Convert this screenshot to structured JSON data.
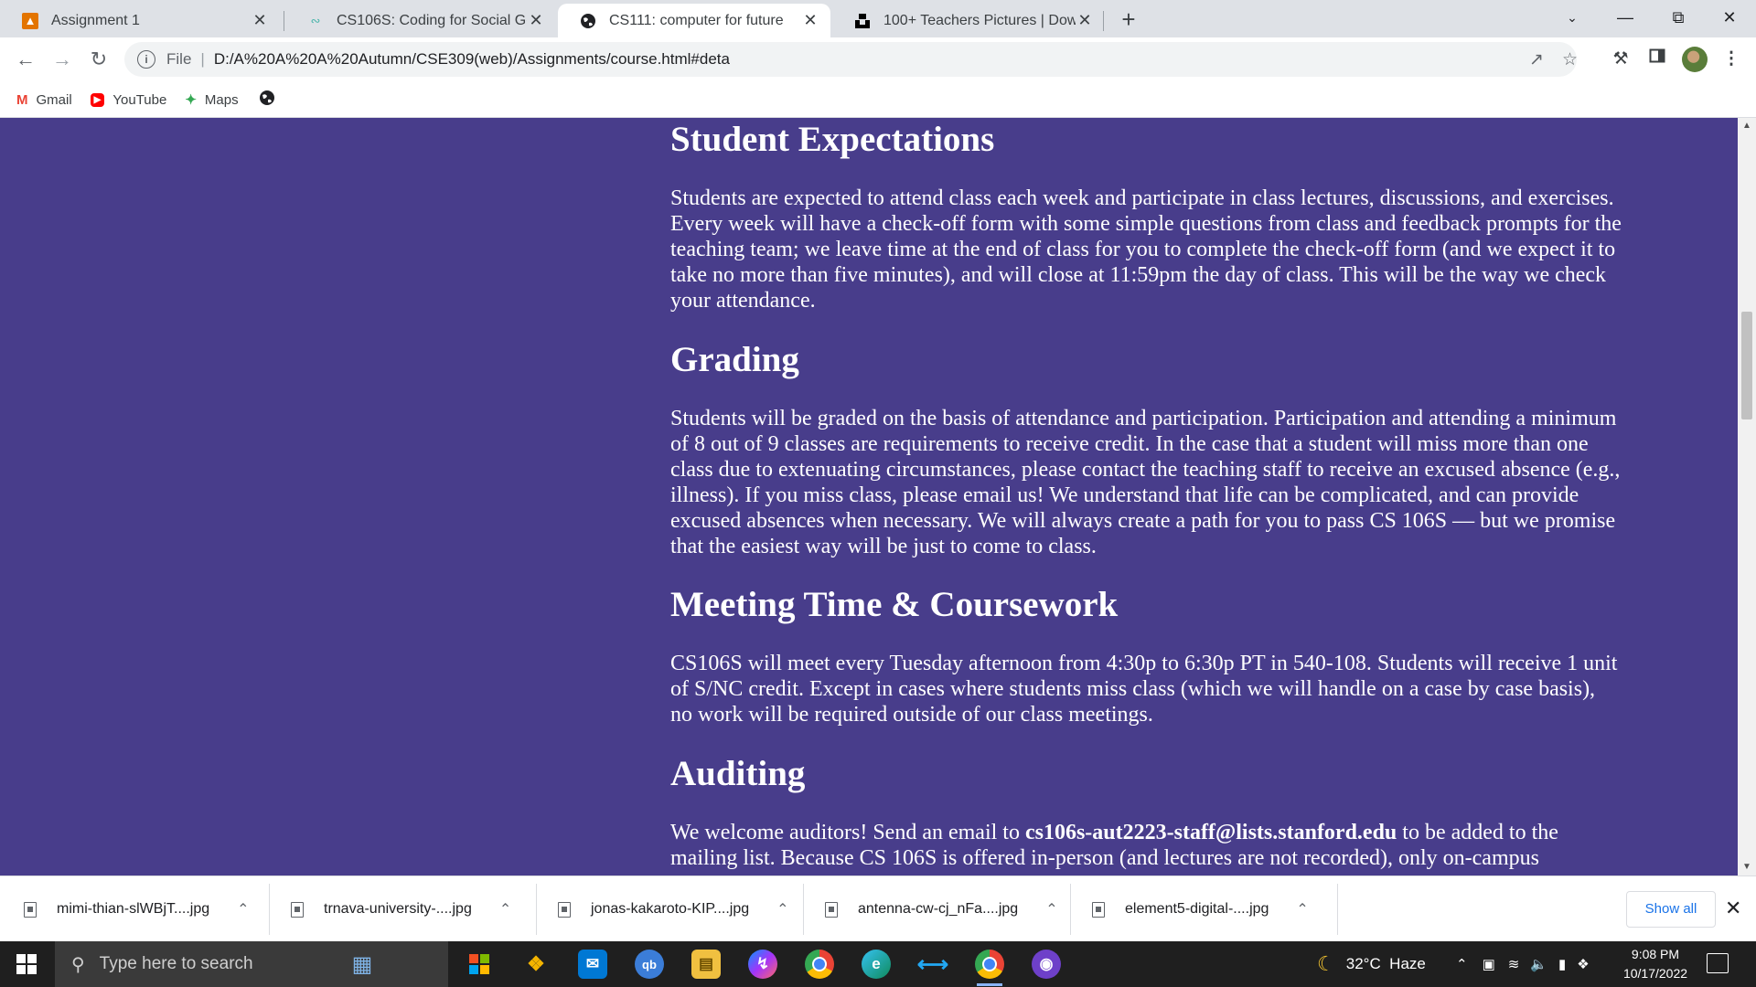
{
  "browser": {
    "tabs": [
      {
        "title": "Assignment 1",
        "favicon": "classroom-icon",
        "color": "#e37400"
      },
      {
        "title": "CS106S: Coding for Social Good",
        "favicon": "cs106s-icon",
        "color": "#4db6ac"
      },
      {
        "title": "CS111: computer for future",
        "favicon": "globe-icon",
        "color": "#202124"
      },
      {
        "title": "100+ Teachers Pictures | Downlo",
        "favicon": "unsplash-icon",
        "color": "#000000"
      }
    ],
    "address": {
      "scheme_label": "File",
      "url": "D:/A%20A%20A%20Autumn/CSE309(web)/Assignments/course.html#deta"
    },
    "bookmarks": [
      {
        "label": "Gmail",
        "icon": "gmail-icon"
      },
      {
        "label": "YouTube",
        "icon": "youtube-icon"
      },
      {
        "label": "Maps",
        "icon": "maps-icon"
      }
    ]
  },
  "article": {
    "sections": [
      {
        "heading": "Student Expectations",
        "body": "Students are expected to attend class each week and participate in class lectures, discussions, and exercises. Every week will have a check-off form with some simple questions from class and feedback prompts for the teaching team; we leave time at the end of class for you to complete the check-off form (and we expect it to take no more than five minutes), and will close at 11:59pm the day of class. This will be the way we check your attendance."
      },
      {
        "heading": "Grading",
        "body": "Students will be graded on the basis of attendance and participation. Participation and attending a minimum of 8 out of 9 classes are requirements to receive credit. In the case that a student will miss more than one class due to extenuating circumstances, please contact the teaching staff to receive an excused absence (e.g., illness). If you miss class, please email us! We understand that life can be complicated, and can provide excused absences when necessary. We will always create a path for you to pass CS 106S — but we promise that the easiest way will be just to come to class."
      },
      {
        "heading": "Meeting Time & Coursework",
        "body": "CS106S will meet every Tuesday afternoon from 4:30p to 6:30p PT in 540-108. Students will receive 1 unit of S/NC credit. Except in cases where students miss class (which we will handle on a case by case basis), no work will be required outside of our class meetings."
      },
      {
        "heading": "Auditing",
        "body_before": "We welcome auditors! Send an email to ",
        "email": "cs106s-aut2223-staff@lists.stanford.edu",
        "body_after": " to be added to the mailing list. Because CS 106S is offered in-person (and lectures are not recorded), only on-campus"
      }
    ]
  },
  "downloads": {
    "items": [
      "mimi-thian-slWBjT....jpg",
      "trnava-university-....jpg",
      "jonas-kakaroto-KIP....jpg",
      "antenna-cw-cj_nFa....jpg",
      "element5-digital-....jpg"
    ],
    "show_all_label": "Show all"
  },
  "taskbar": {
    "search_placeholder": "Type here to search",
    "weather": "32°C  Haze",
    "time": "9:08 PM",
    "date": "10/17/2022"
  },
  "colors": {
    "page_background": "#483d8b",
    "text": "#ffffff"
  }
}
